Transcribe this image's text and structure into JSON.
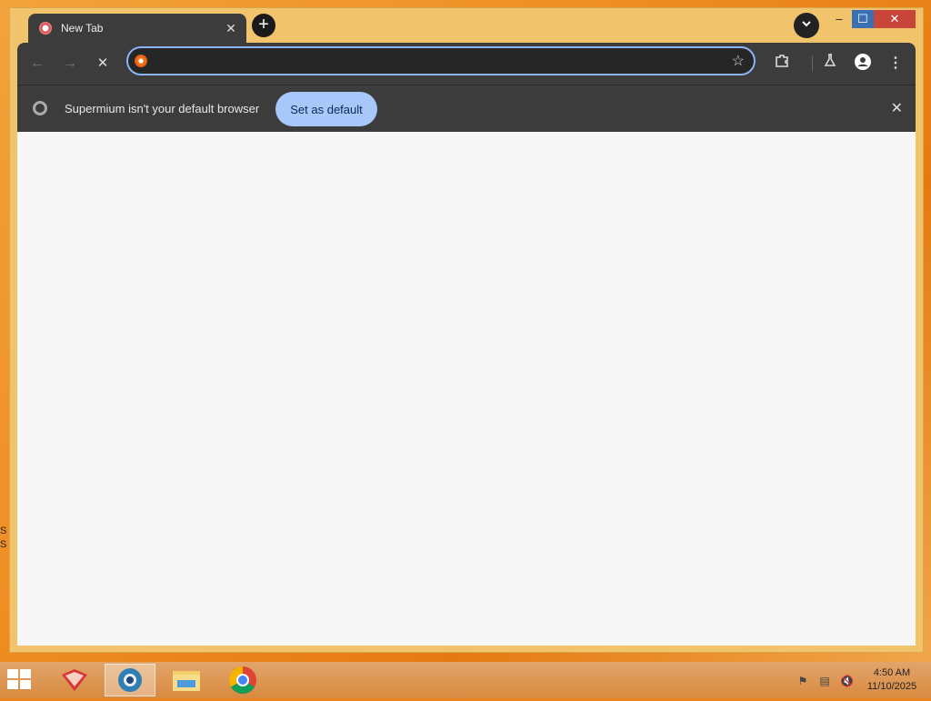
{
  "browser": {
    "tab": {
      "title": "New Tab",
      "close_glyph": "✕"
    },
    "new_tab_glyph": "+",
    "tab_search_glyph": "⌄",
    "window_controls": {
      "minimize": "–",
      "maximize": "☐",
      "close": "✕"
    },
    "toolbar": {
      "back_glyph": "←",
      "forward_glyph": "→",
      "stop_glyph": "✕",
      "address_value": "",
      "address_placeholder": "",
      "bookmark_glyph": "☆",
      "extensions_glyph": "⧉",
      "labs_glyph": "⚗",
      "profile_glyph": "●",
      "menu_glyph": "⋮"
    },
    "infobar": {
      "message": "Supermium isn't your default browser",
      "action_label": "Set as default",
      "close_glyph": "✕"
    }
  },
  "taskbar": {
    "apps": [
      "app-red-icon",
      "supermium-icon",
      "file-explorer-icon",
      "chrome-icon"
    ],
    "active_app": "supermium-icon",
    "tray": [
      "action-center-flag-icon",
      "network-icon",
      "volume-muted-icon"
    ],
    "clock_time": "4:50 AM",
    "clock_date": "11/10/2025"
  },
  "desktop": {
    "edge_text": [
      "S",
      "S"
    ]
  },
  "colors": {
    "window_frame": "#f1c36a",
    "toolbar_bg": "#3c3c3c",
    "accent_button": "#a8c7fa",
    "omnibox_border": "#8ab4f8",
    "content_bg": "#f6f6f7"
  }
}
